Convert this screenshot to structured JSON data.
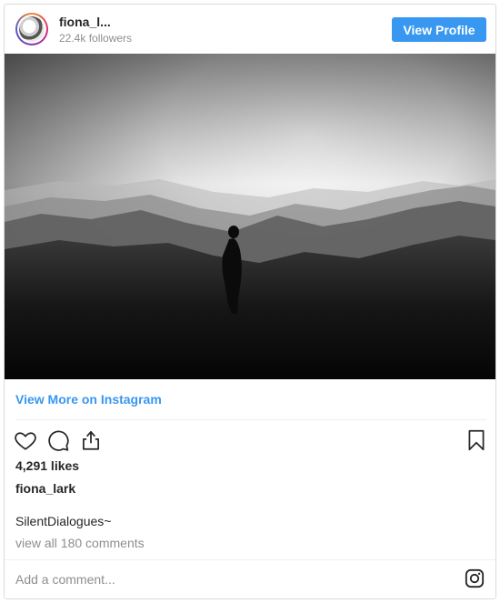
{
  "header": {
    "username": "fiona_l...",
    "followers": "22.4k followers",
    "view_profile_label": "View Profile"
  },
  "post": {
    "view_more_label": "View More on Instagram",
    "likes": "4,291 likes",
    "author": "fiona_lark",
    "caption": "SilentDialogues~",
    "comments_link": "view all 180 comments",
    "comment_placeholder": "Add a comment..."
  },
  "icons": {
    "like": "heart-icon",
    "comment": "comment-bubble-icon",
    "share": "share-icon",
    "save": "bookmark-icon",
    "instagram": "instagram-icon"
  },
  "colors": {
    "accent": "#3897f0",
    "text": "#262626",
    "muted": "#8e8e8e",
    "border": "#dbdbdb"
  }
}
